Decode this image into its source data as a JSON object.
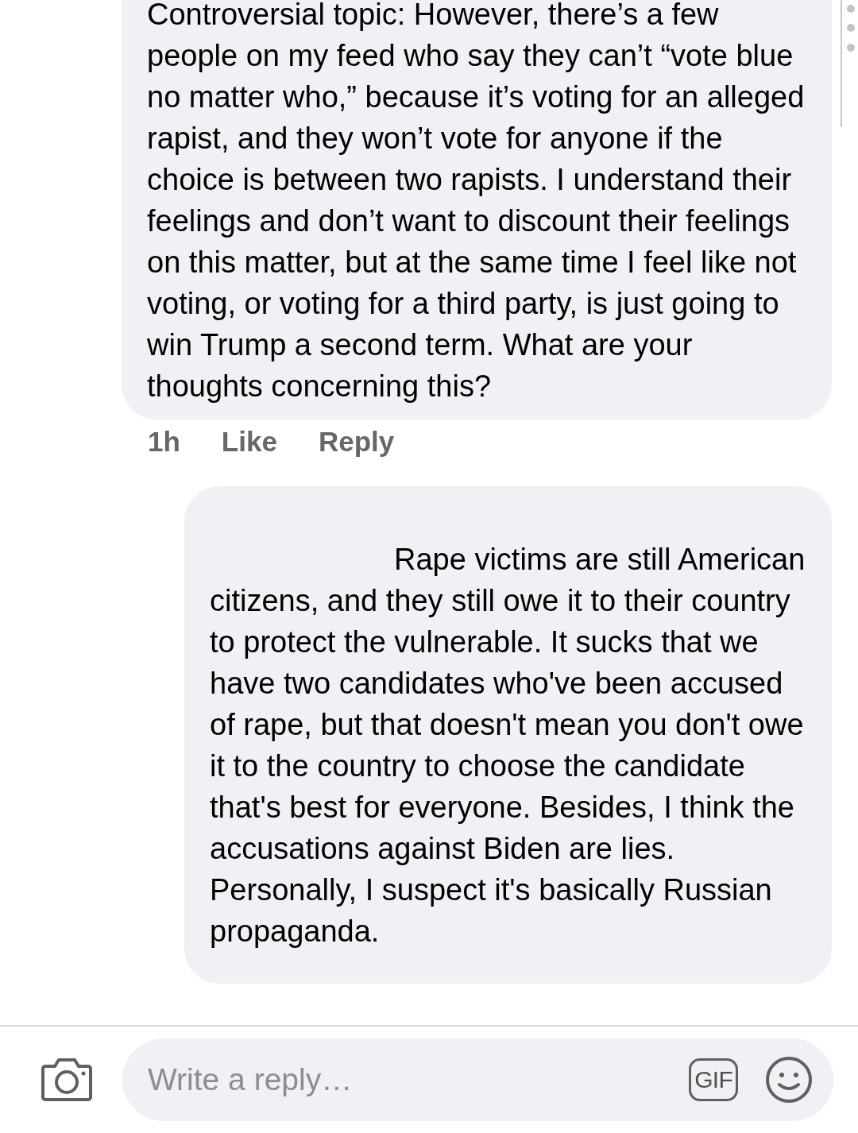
{
  "comments": [
    {
      "text": "Controversial topic: However, there’s a few people on my feed who say they can’t “vote blue no matter who,” because it’s voting for an alleged rapist, and they won’t vote for anyone if the choice is between two rapists. I understand their feelings and don’t want to discount their feelings on this matter, but at the same time I feel like not voting, or voting for a third party, is just going to win Trump a second term. What are your thoughts concerning this?",
      "time": "1h",
      "actions": [
        "Like",
        "Reply"
      ]
    },
    {
      "text": "Rape victims are still American citizens, and they still owe it to their country to protect the vulnerable. It sucks that we have two candidates who've been accused of rape, but that doesn't mean you don't owe it to the country to choose the candidate that's best for everyone. Besides, I think the accusations against Biden are lies. Personally, I suspect it's basically Russian propaganda."
    }
  ],
  "reply_bar": {
    "placeholder": "Write a reply…",
    "gif_label": "GIF"
  }
}
